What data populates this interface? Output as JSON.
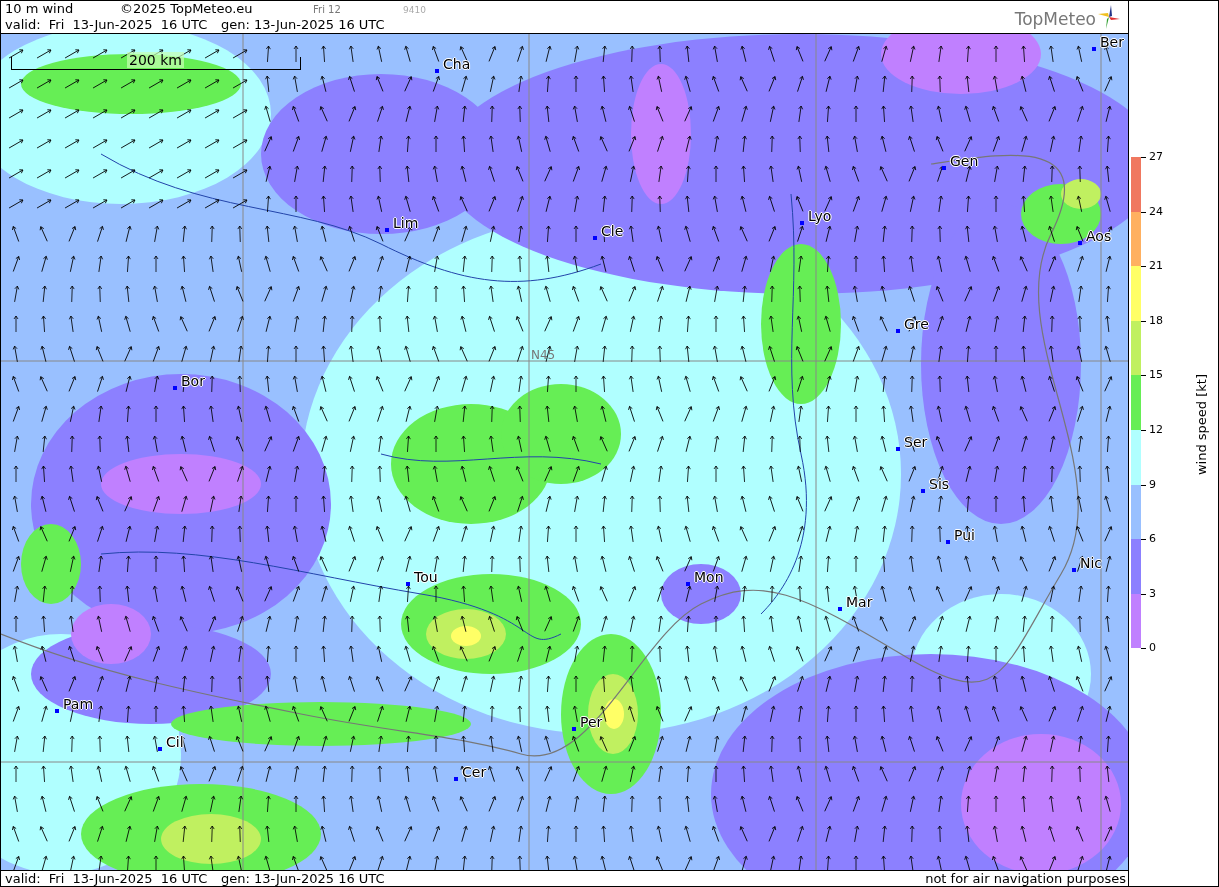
{
  "header": {
    "title": "10 m wind",
    "copyright": "©2025 TopMeteo.eu",
    "day": "Fri 12",
    "code": "9410",
    "valid": "valid:  Fri  13-Jun-2025  16 UTC",
    "gen": "gen: 13-Jun-2025 16 UTC",
    "logo": "TopMeteo"
  },
  "map": {
    "scale": "200 km",
    "grid_label": "N45",
    "cities": [
      {
        "name": "Cha"
      },
      {
        "name": "Ber"
      },
      {
        "name": "Gen"
      },
      {
        "name": "Lim"
      },
      {
        "name": "Cle"
      },
      {
        "name": "Lyo"
      },
      {
        "name": "Aos"
      },
      {
        "name": "Gre"
      },
      {
        "name": "Bor"
      },
      {
        "name": "Ser"
      },
      {
        "name": "Sis"
      },
      {
        "name": "Pui"
      },
      {
        "name": "Nic"
      },
      {
        "name": "Tou"
      },
      {
        "name": "Mon"
      },
      {
        "name": "Mar"
      },
      {
        "name": "Pam"
      },
      {
        "name": "Per"
      },
      {
        "name": "Cil"
      },
      {
        "name": "Cer"
      }
    ]
  },
  "legend": {
    "title": "wind speed [kt]",
    "ticks": [
      "27",
      "24",
      "21",
      "18",
      "15",
      "12",
      "9",
      "6",
      "3",
      "0"
    ],
    "bands": [
      {
        "color": "#f07860"
      },
      {
        "color": "#ffb060"
      },
      {
        "color": "#ffff66"
      },
      {
        "color": "#c0f060"
      },
      {
        "color": "#66ee55"
      },
      {
        "color": "#b0ffff"
      },
      {
        "color": "#99c0ff"
      },
      {
        "color": "#8c80ff"
      },
      {
        "color": "#c080ff"
      }
    ]
  },
  "footer": {
    "valid": "valid:  Fri  13-Jun-2025  16 UTC",
    "gen": "gen: 13-Jun-2025 16 UTC",
    "note": "not for air navigation purposes"
  }
}
